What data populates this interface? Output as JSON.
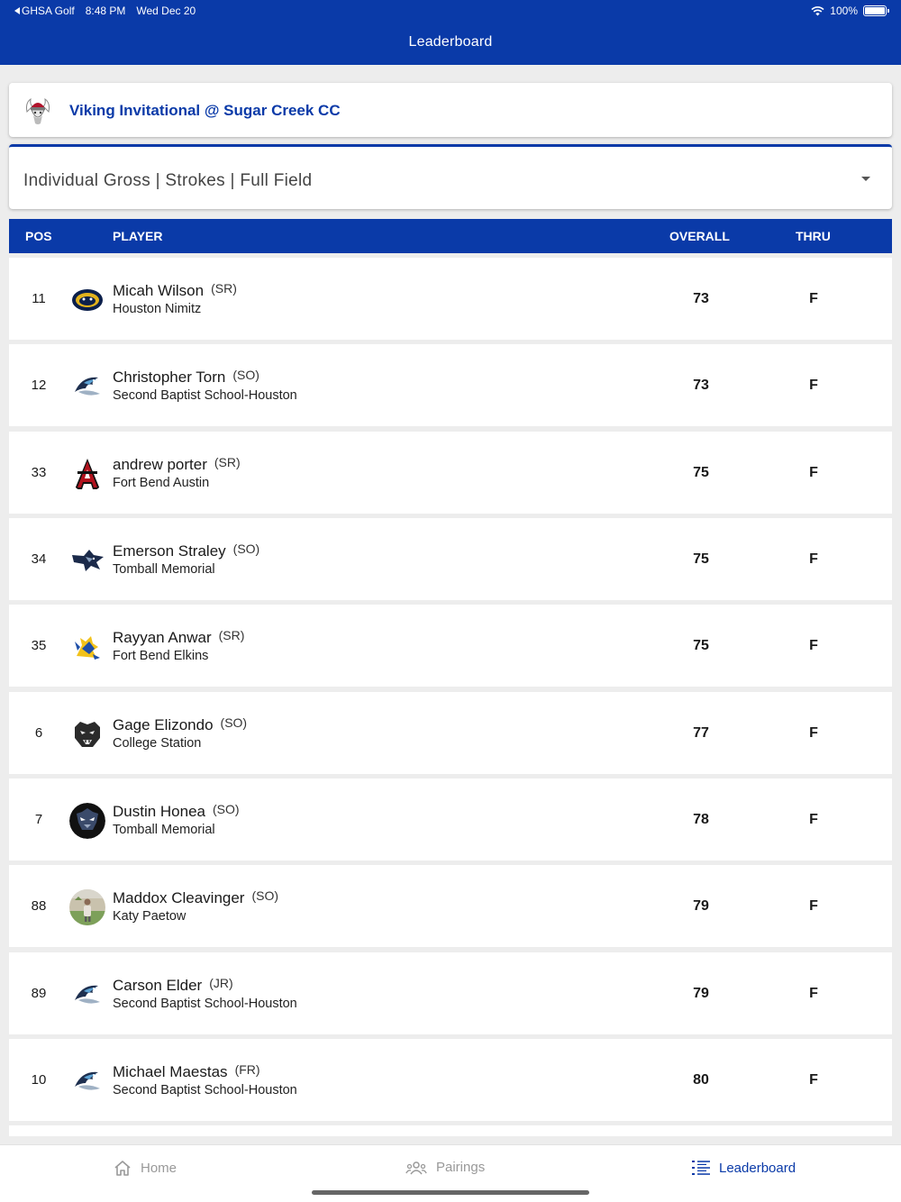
{
  "status_bar": {
    "back_app": "GHSA Golf",
    "time": "8:48 PM",
    "date": "Wed Dec 20",
    "battery": "100%"
  },
  "nav": {
    "title": "Leaderboard"
  },
  "tournament": {
    "name": "Viking Invitational @ Sugar Creek CC",
    "logo_icon": "viking-logo-icon"
  },
  "filter": {
    "value": "Individual Gross | Strokes | Full Field"
  },
  "columns": {
    "pos": "POS",
    "player": "PLAYER",
    "overall": "OVERALL",
    "thru": "THRU"
  },
  "rows": [
    {
      "pos": "11",
      "name": "Micah Wilson",
      "grade": "(SR)",
      "school": "Houston Nimitz",
      "overall": "73",
      "thru": "F",
      "logo": "nimitz-logo-icon"
    },
    {
      "pos": "12",
      "name": "Christopher Torn",
      "grade": "(SO)",
      "school": "Second Baptist School-Houston",
      "overall": "73",
      "thru": "F",
      "logo": "eagle-logo-icon"
    },
    {
      "pos": "33",
      "name": "andrew porter",
      "grade": "(SR)",
      "school": "Fort Bend Austin",
      "overall": "75",
      "thru": "F",
      "logo": "austin-a-logo-icon"
    },
    {
      "pos": "34",
      "name": "Emerson Straley",
      "grade": "(SO)",
      "school": "Tomball Memorial",
      "overall": "75",
      "thru": "F",
      "logo": "wildcat-logo-icon"
    },
    {
      "pos": "35",
      "name": "Rayyan Anwar",
      "grade": "(SR)",
      "school": "Fort Bend Elkins",
      "overall": "75",
      "thru": "F",
      "logo": "knight-logo-icon"
    },
    {
      "pos": "6",
      "name": "Gage Elizondo",
      "grade": "(SO)",
      "school": "College Station",
      "overall": "77",
      "thru": "F",
      "logo": "cougar-logo-icon"
    },
    {
      "pos": "7",
      "name": "Dustin Honea",
      "grade": "(SO)",
      "school": "Tomball Memorial",
      "overall": "78",
      "thru": "F",
      "logo": "wildcat-dark-logo-icon"
    },
    {
      "pos": "88",
      "name": "Maddox Cleavinger",
      "grade": "(SO)",
      "school": "Katy Paetow",
      "overall": "79",
      "thru": "F",
      "logo": "player-photo"
    },
    {
      "pos": "89",
      "name": "Carson Elder",
      "grade": "(JR)",
      "school": "Second Baptist School-Houston",
      "overall": "79",
      "thru": "F",
      "logo": "eagle-logo-icon"
    },
    {
      "pos": "10",
      "name": "Michael Maestas",
      "grade": "(FR)",
      "school": "Second Baptist School-Houston",
      "overall": "80",
      "thru": "F",
      "logo": "eagle-logo-icon"
    }
  ],
  "tabs": [
    {
      "label": "Home",
      "icon": "home-icon"
    },
    {
      "label": "Pairings",
      "icon": "people-icon"
    },
    {
      "label": "Leaderboard",
      "icon": "list-icon",
      "active": true
    }
  ],
  "colors": {
    "brand": "#0a3aa8",
    "background": "#ededed",
    "inactive_tab": "#999999"
  }
}
